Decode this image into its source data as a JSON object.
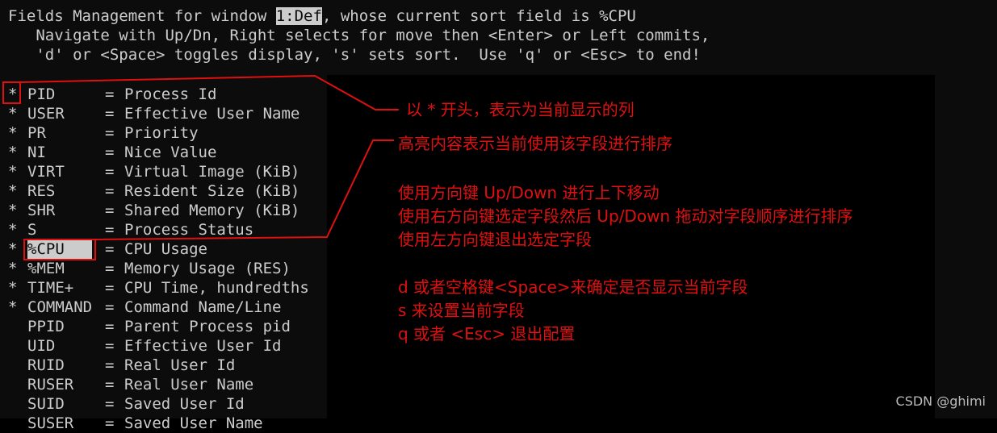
{
  "header": {
    "line1_prefix": "Fields Management for window ",
    "line1_window": "1:Def",
    "line1_suffix": ", whose current sort field is %CPU",
    "line2": "   Navigate with Up/Dn, Right selects for move then <Enter> or Left commits,",
    "line3": "   'd' or <Space> toggles display, 's' sets sort.  Use 'q' or <Esc> to end!"
  },
  "fields": [
    {
      "mark": "*",
      "code": "PID",
      "desc": "Process Id"
    },
    {
      "mark": "*",
      "code": "USER",
      "desc": "Effective User Name"
    },
    {
      "mark": "*",
      "code": "PR",
      "desc": "Priority"
    },
    {
      "mark": "*",
      "code": "NI",
      "desc": "Nice Value"
    },
    {
      "mark": "*",
      "code": "VIRT",
      "desc": "Virtual Image (KiB)"
    },
    {
      "mark": "*",
      "code": "RES",
      "desc": "Resident Size (KiB)"
    },
    {
      "mark": "*",
      "code": "SHR",
      "desc": "Shared Memory (KiB)"
    },
    {
      "mark": "*",
      "code": "S",
      "desc": "Process Status"
    },
    {
      "mark": "*",
      "code": "%CPU",
      "desc": "CPU Usage"
    },
    {
      "mark": "*",
      "code": "%MEM",
      "desc": "Memory Usage (RES)"
    },
    {
      "mark": "*",
      "code": "TIME+",
      "desc": "CPU Time, hundredths"
    },
    {
      "mark": "*",
      "code": "COMMAND",
      "desc": "Command Name/Line"
    },
    {
      "mark": "",
      "code": "PPID",
      "desc": "Parent Process pid"
    },
    {
      "mark": "",
      "code": "UID",
      "desc": "Effective User Id"
    },
    {
      "mark": "",
      "code": "RUID",
      "desc": "Real User Id"
    },
    {
      "mark": "",
      "code": "RUSER",
      "desc": "Real User Name"
    },
    {
      "mark": "",
      "code": "SUID",
      "desc": "Saved User Id"
    },
    {
      "mark": "",
      "code": "SUSER",
      "desc": "Saved User Name"
    }
  ],
  "annotations": {
    "a1": "以 * 开头，表示为当前显示的列",
    "a2": "高亮内容表示当前使用该字段进行排序",
    "a3": "使用方向键 Up/Down 进行上下移动",
    "a4": "使用右方向键选定字段然后 Up/Down 拖动对字段顺序进行排序",
    "a5": "使用左方向键退出选定字段",
    "a6": "d 或者空格键<Space>来确定是否显示当前字段",
    "a7": "s 来设置当前字段",
    "a8": "q 或者 <Esc> 退出配置"
  },
  "watermark": "CSDN @ghimi",
  "colors": {
    "annotation": "#e01010",
    "terminal_bg": "#0c0c0c",
    "terminal_fg": "#cccccc"
  }
}
